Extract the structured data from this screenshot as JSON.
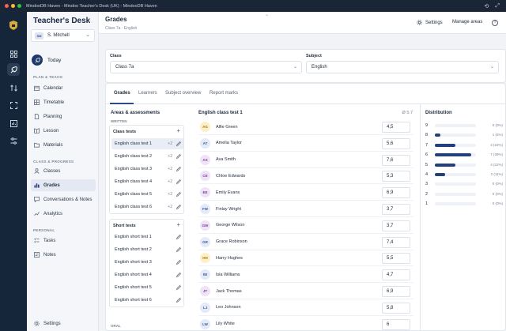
{
  "window": {
    "title": "MindooDB Haven - Mindoo Teacher's Desk (UK) - MindooDB Haven"
  },
  "brand": {
    "name": "Teacher's Desk"
  },
  "user": {
    "initials": "SM",
    "name": "S. Mitchell"
  },
  "sidebar": {
    "today": "Today",
    "plan_label": "PLAN & TEACH",
    "plan_items": [
      "Calendar",
      "Timetable",
      "Planning",
      "Lesson",
      "Materials"
    ],
    "class_label": "CLASS & PROGRESS",
    "class_items": [
      "Classes",
      "Grades",
      "Conversations & Notes",
      "Analytics"
    ],
    "personal_label": "PERSONAL",
    "personal_items": [
      "Tasks",
      "Notes"
    ],
    "settings": "Settings"
  },
  "header": {
    "title": "Grades",
    "breadcrumb": "Class 7a · English",
    "settings_label": "Settings",
    "manage_areas_label": "Manage areas",
    "help": "?"
  },
  "filters": {
    "class_label": "Class",
    "class_value": "Class 7a",
    "subject_label": "Subject",
    "subject_value": "English"
  },
  "tabs": [
    "Grades",
    "Learners",
    "Subject overview",
    "Report marks"
  ],
  "areas": {
    "title": "Areas & assessments",
    "written_label": "WRITTEN",
    "class_tests_title": "Class tests",
    "class_tests": [
      {
        "name": "English class test 1",
        "count": "+2"
      },
      {
        "name": "English class test 2",
        "count": "+2"
      },
      {
        "name": "English class test 3",
        "count": "+2"
      },
      {
        "name": "English class test 4",
        "count": "+2"
      },
      {
        "name": "English class test 5",
        "count": "+2"
      },
      {
        "name": "English class test 6",
        "count": "+2"
      }
    ],
    "short_tests_title": "Short tests",
    "short_tests": [
      "English short test 1",
      "English short test 2",
      "English short test 3",
      "English short test 4",
      "English short test 5",
      "English short test 6"
    ],
    "oral_label": "ORAL"
  },
  "grades": {
    "title": "English class test 1",
    "average": "Ø 5.7",
    "students": [
      {
        "initials": "AG",
        "name": "Alfie Green",
        "grade": "4,5",
        "bg": "#fdf0c8",
        "fg": "#a8761a"
      },
      {
        "initials": "AT",
        "name": "Amelia Taylor",
        "grade": "5,6",
        "bg": "#e4eaf7",
        "fg": "#3b5a9a"
      },
      {
        "initials": "AS",
        "name": "Ava Smith",
        "grade": "7,6",
        "bg": "#efe4f7",
        "fg": "#7a3d9a"
      },
      {
        "initials": "CE",
        "name": "Chloe Edwards",
        "grade": "5,3",
        "bg": "#efe4f7",
        "fg": "#7a3d9a"
      },
      {
        "initials": "EE",
        "name": "Emily Evans",
        "grade": "6,9",
        "bg": "#efe4f7",
        "fg": "#7a3d9a"
      },
      {
        "initials": "FW",
        "name": "Finlay Wright",
        "grade": "3,7",
        "bg": "#e4eaf7",
        "fg": "#3b5a9a"
      },
      {
        "initials": "GW",
        "name": "George Wilson",
        "grade": "3,7",
        "bg": "#efe4f7",
        "fg": "#7a3d9a"
      },
      {
        "initials": "GR",
        "name": "Grace Robinson",
        "grade": "7,4",
        "bg": "#e4eaf7",
        "fg": "#3b5a9a"
      },
      {
        "initials": "HH",
        "name": "Harry Hughes",
        "grade": "5,5",
        "bg": "#fdf0c8",
        "fg": "#a8761a"
      },
      {
        "initials": "IW",
        "name": "Isla Williams",
        "grade": "4,7",
        "bg": "#e4eaf7",
        "fg": "#3b5a9a"
      },
      {
        "initials": "JT",
        "name": "Jack Thomas",
        "grade": "6,9",
        "bg": "#efe4f7",
        "fg": "#7a3d9a"
      },
      {
        "initials": "LJ",
        "name": "Leo Johnson",
        "grade": "5,8",
        "bg": "#e4eaf7",
        "fg": "#3b5a9a"
      },
      {
        "initials": "LW",
        "name": "Lily White",
        "grade": "6",
        "bg": "#e4eaf7",
        "fg": "#3b5a9a"
      }
    ]
  },
  "distribution": {
    "title": "Distribution",
    "rows": [
      {
        "grade": "9",
        "fraction": 0,
        "count": "0 (0%)"
      },
      {
        "grade": "8",
        "fraction": 0.06,
        "count": "1 (6%)"
      },
      {
        "grade": "7",
        "fraction": 0.22,
        "count": "4 (22%)"
      },
      {
        "grade": "6",
        "fraction": 0.39,
        "count": "7 (39%)"
      },
      {
        "grade": "5",
        "fraction": 0.22,
        "count": "4 (22%)"
      },
      {
        "grade": "4",
        "fraction": 0.11,
        "count": "2 (11%)"
      },
      {
        "grade": "3",
        "fraction": 0,
        "count": "0 (0%)"
      },
      {
        "grade": "2",
        "fraction": 0,
        "count": "0 (0%)"
      },
      {
        "grade": "1",
        "fraction": 0,
        "count": "0 (0%)"
      }
    ]
  },
  "colors": {
    "accent": "#23407a",
    "rail": "#15253a"
  }
}
